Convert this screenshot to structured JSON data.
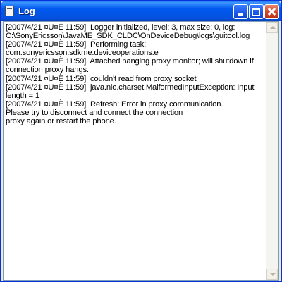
{
  "window": {
    "title": "Log",
    "icon": "log-document-icon"
  },
  "title_buttons": {
    "minimize": "minimize-icon",
    "maximize": "maximize-icon",
    "close": "close-icon"
  },
  "log_text": "[2007/4/21 ¤U¤È 11:59]  Logger initialized, level: 3, max size: 0, log: C:\\SonyEricsson\\JavaME_SDK_CLDC\\OnDeviceDebug\\logs\\guitool.log\n[2007/4/21 ¤U¤È 11:59]  Performing task: com.sonyericsson.sdkme.deviceoperations.e\n[2007/4/21 ¤U¤È 11:59]  Attached hanging proxy monitor; will shutdown if connection proxy hangs.\n[2007/4/21 ¤U¤È 11:59]  couldn't read from proxy socket\n[2007/4/21 ¤U¤È 11:59]  java.nio.charset.MalformedInputException: Input length = 1\n[2007/4/21 ¤U¤È 11:59]  Refresh: Error in proxy communication.\nPlease try to disconnect and connect the connection\nproxy again or restart the phone.",
  "colors": {
    "titlebar": "#0058ee",
    "close_button": "#d2452a",
    "client_background": "#ffffff"
  }
}
